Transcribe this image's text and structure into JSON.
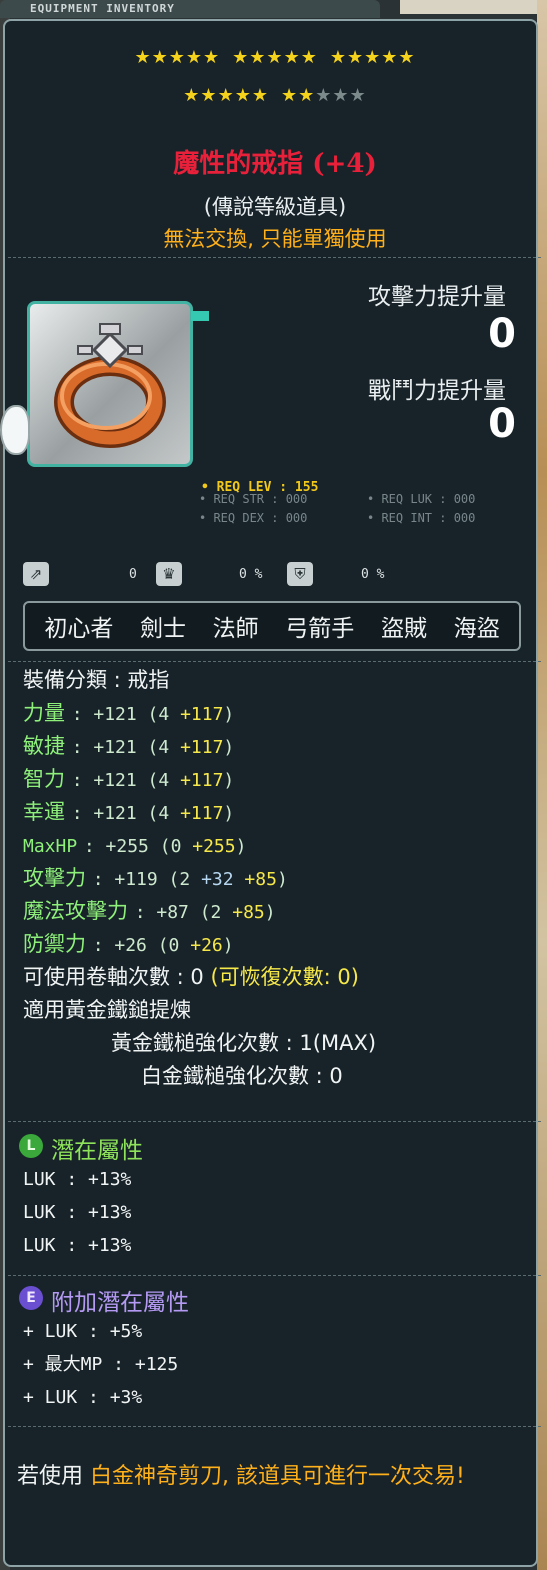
{
  "window": {
    "title": "EQUIPMENT INVENTORY"
  },
  "stars": {
    "filled": 22,
    "total": 25,
    "row1": 15,
    "row2": 10
  },
  "item": {
    "name": "魔性的戒指 (+4)",
    "grade": "(傳說等級道具)",
    "trade_note": "無法交換, 只能單獨使用"
  },
  "upgrade": {
    "attack_label": "攻擊力提升量",
    "attack_value": "0",
    "combat_label": "戰鬥力提升量",
    "combat_value": "0"
  },
  "requirements": {
    "lev": "• REQ LEV : 155",
    "str": "• REQ STR : 000",
    "dex": "• REQ DEX : 000",
    "luk": "• REQ LUK : 000",
    "int": "• REQ INT : 000"
  },
  "mini_stats": [
    "0",
    "0 %",
    "0 %"
  ],
  "jobs": [
    "初心者",
    "劍士",
    "法師",
    "弓箭手",
    "盜賊",
    "海盜"
  ],
  "stats": {
    "category": "裝備分類 : 戒指",
    "str_label": "力量",
    "str_val": ": +121 (4 ",
    "str_bonus": "+117",
    "str_end": ")",
    "dex_label": "敏捷",
    "dex_val": ": +121 (4 ",
    "dex_bonus": "+117",
    "dex_end": ")",
    "int_label": "智力",
    "int_val": ": +121 (4 ",
    "int_bonus": "+117",
    "int_end": ")",
    "luk_label": "幸運",
    "luk_val": ": +121 (4 ",
    "luk_bonus": "+117",
    "luk_end": ")",
    "hp_label": "MaxHP",
    "hp_val": ": +255 (0 ",
    "hp_bonus": "+255",
    "hp_end": ")",
    "atk_label": "攻擊力",
    "atk_val": ": +119 (2 ",
    "atk_bonus1": "+32",
    "atk_bonus2": " +85",
    "atk_end": ")",
    "matk_label": "魔法攻擊力",
    "matk_val": ": +87 (2 ",
    "matk_bonus": "+85",
    "matk_end": ")",
    "def_label": "防禦力",
    "def_val": ": +26 (0 ",
    "def_bonus": "+26",
    "def_end": ")",
    "scroll": "可使用卷軸次數 : 0 ",
    "scroll_recover": "(可恢復次數: 0)",
    "hammer": "適用黃金鐵鎚提煉",
    "gold_hammer": "黃金鐵槌強化次數 : 1(MAX)",
    "plat_hammer": "白金鐵槌強化次數 : 0"
  },
  "potential": {
    "icon": "L",
    "title": "潛在屬性",
    "lines": [
      "LUK : +13%",
      "LUK : +13%",
      "LUK : +13%"
    ]
  },
  "bonus_potential": {
    "icon": "E",
    "title": "附加潛在屬性",
    "lines": [
      "+ LUK : +5%",
      "+ 最大MP : +125",
      "+ LUK : +3%"
    ]
  },
  "footer": {
    "prefix": "若使用 ",
    "item": "白金神奇剪刀, 該道具可進行一次交易!"
  },
  "colors": {
    "name": "#e8203a",
    "trade": "#ffb01a",
    "stat_green": "#8ef07a",
    "bonus_yellow": "#f7e84a",
    "potential_green": "#8ee35a",
    "bonus_potential_purple": "#b59af3",
    "border": "#8ea3a6"
  }
}
